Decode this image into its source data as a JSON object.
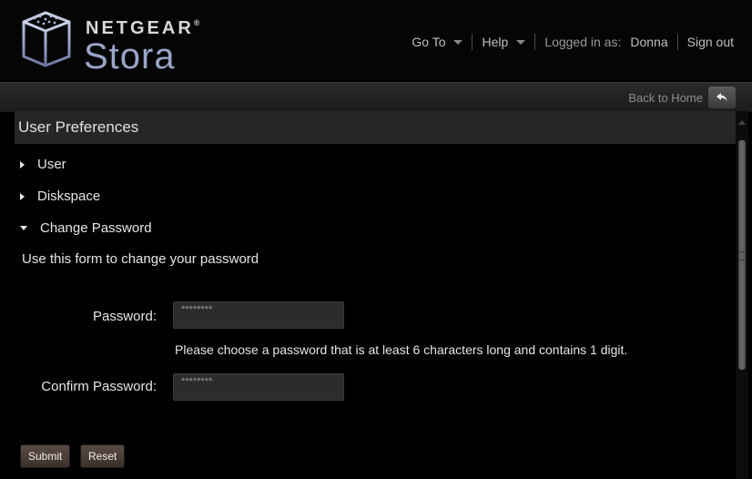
{
  "logo": {
    "brand": "NETGEAR",
    "registered": "®",
    "product": "Stora"
  },
  "nav": {
    "goto": "Go To",
    "help": "Help",
    "logged_in_label": "Logged in as:",
    "user": "Donna",
    "sign_out": "Sign out"
  },
  "back": {
    "label": "Back to Home"
  },
  "page": {
    "title": "User Preferences"
  },
  "sections": [
    "User",
    "Diskspace",
    "Change Password"
  ],
  "form": {
    "description": "Use this form to change your password",
    "password_label": "Password:",
    "password_value": "********",
    "hint": "Please choose a password that is at least 6 characters long and contains 1 digit.",
    "confirm_label": "Confirm Password:",
    "confirm_value": "********",
    "submit": "Submit",
    "reset": "Reset"
  }
}
